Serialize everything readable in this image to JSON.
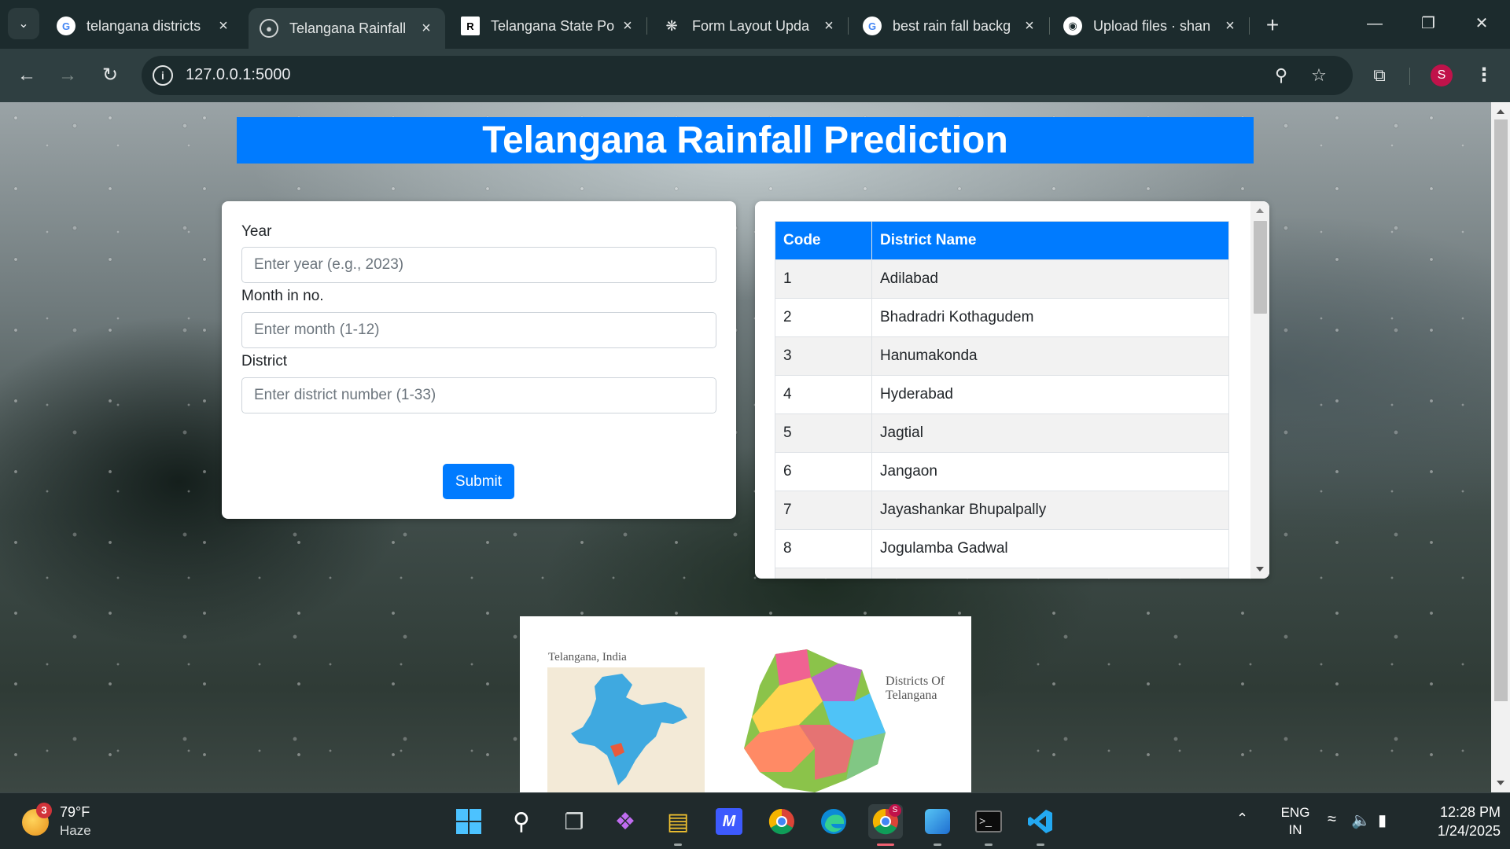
{
  "browser": {
    "tabs": [
      {
        "title": "telangana districts",
        "favicon": "google-icon"
      },
      {
        "title": "Telangana Rainfall",
        "favicon": "globe-icon",
        "active": true
      },
      {
        "title": "Telangana State Po",
        "favicon": "rs-icon"
      },
      {
        "title": "Form Layout Upda",
        "favicon": "openai-icon"
      },
      {
        "title": "best rain fall backg",
        "favicon": "google-icon"
      },
      {
        "title": "Upload files · shan",
        "favicon": "github-icon"
      }
    ],
    "url": "127.0.0.1:5000",
    "profile_initial": "S",
    "accent": "#007bff"
  },
  "page": {
    "title": "Telangana Rainfall Prediction",
    "form": {
      "year_label": "Year",
      "year_placeholder": "Enter year (e.g., 2023)",
      "month_label": "Month in no.",
      "month_placeholder": "Enter month (1-12)",
      "district_label": "District",
      "district_placeholder": "Enter district number (1-33)",
      "submit_label": "Submit"
    },
    "district_table": {
      "headers": [
        "Code",
        "District Name"
      ],
      "rows": [
        [
          "1",
          "Adilabad"
        ],
        [
          "2",
          "Bhadradri Kothagudem"
        ],
        [
          "3",
          "Hanumakonda"
        ],
        [
          "4",
          "Hyderabad"
        ],
        [
          "5",
          "Jagtial"
        ],
        [
          "6",
          "Jangaon"
        ],
        [
          "7",
          "Jayashankar Bhupalpally"
        ],
        [
          "8",
          "Jogulamba Gadwal"
        ]
      ]
    },
    "map": {
      "caption_left": "Telangana, India",
      "caption_right": "Districts Of Telangana"
    }
  },
  "taskbar": {
    "weather_badge": "3",
    "temperature": "79°F",
    "condition": "Haze",
    "language": "ENG",
    "region": "IN",
    "time": "12:28 PM",
    "date": "1/24/2025",
    "chrome_badge": "S"
  }
}
